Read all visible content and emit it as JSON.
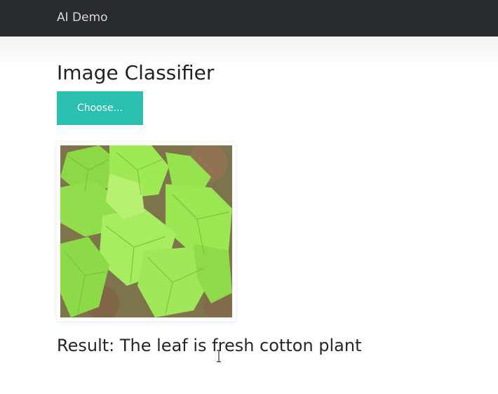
{
  "navbar": {
    "brand": "AI Demo"
  },
  "main": {
    "title": "Image Classifier",
    "choose_button_label": "Choose...",
    "result_text": "Result: The leaf is fresh cotton plant"
  },
  "image": {
    "alt": "cotton plant leaves",
    "icon": "photo-thumbnail"
  },
  "colors": {
    "navbar_bg": "#272a2e",
    "button_bg": "#2bbfb0",
    "leaf_green": "#8fe24a",
    "soil_brown": "#8a6a45"
  }
}
